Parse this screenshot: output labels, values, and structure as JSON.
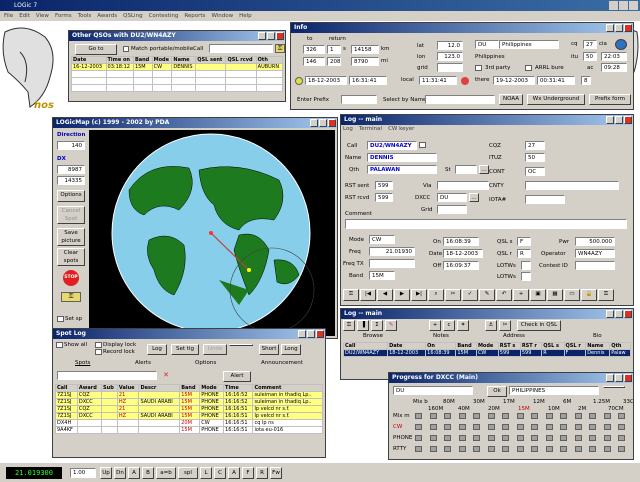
{
  "app": {
    "title": "LOGic 7",
    "menu": [
      "File",
      "Edit",
      "View",
      "Forms",
      "Tools",
      "Awards",
      "QSLing",
      "Contesting",
      "Reports",
      "Window",
      "Help"
    ]
  },
  "qso_window": {
    "title": "Other QSOs with DU2/WN4AZY",
    "goto": "Go to",
    "match_label": "Match portable/mobile",
    "call_label": "Call",
    "columns": [
      "Date",
      "Time on",
      "Band",
      "Mode",
      "Name",
      "QSL sent",
      "QSL rcvd",
      "Oth"
    ],
    "row": [
      "16-12-2003",
      "03:18:12",
      "15M",
      "CW",
      "DENNIS",
      "",
      "",
      "AUBURN"
    ]
  },
  "info": {
    "title": "Info",
    "to_label": "to",
    "return_label": "return",
    "km": [
      "326",
      "1",
      "14158"
    ],
    "mi": [
      "146",
      "208",
      "8790"
    ],
    "unit_s": "s",
    "unit_km": "km",
    "unit_mi": "mi",
    "lat_label": "lat",
    "lat": "12.0",
    "lon_label": "lon",
    "lon": "123.0",
    "grid_label": "grid",
    "grid": "",
    "date": "18-12-2003",
    "time": "16:31:41",
    "local_label": "local",
    "local_time": "11:31:41",
    "there_label": "there",
    "there_date": "19-12-2003",
    "there_time": "00:31:41",
    "entity": "DU",
    "country": "Philippines",
    "cq_label": "cq",
    "cq": "27",
    "cia": "cia",
    "itu_label": "itu",
    "itu": "50",
    "time2": "22:03",
    "ac_label": "ac",
    "ac": "09:28",
    "third_party": "3rd party",
    "arrl": "ARRL bure",
    "prefix_label": "Enter Prefix",
    "select_label": "Select by Name",
    "noaa": "NOAA",
    "wx": "Wx Underground",
    "prefix_form": "Prefix form",
    "there_extra": "8"
  },
  "map": {
    "title": "LOGicMap  (c) 1999 - 2002 by PDA",
    "direction_label": "Direction",
    "direction": "140",
    "dx_label": "DX",
    "dx1": "8987",
    "dx2": "14335",
    "options": "Options",
    "cancel_label": "Cancel Spot",
    "save": "Save picture",
    "clear": "Clear spots",
    "stop": "STOP",
    "set_lbl": "Set sp"
  },
  "log": {
    "title": "Log -- main",
    "menu": [
      "Log",
      "Terminal",
      "CW keyer"
    ],
    "call_label": "Call",
    "call": "DU2/WN4AZY",
    "name_label": "Name",
    "name": "DENNIS",
    "qth_label": "Qth",
    "qth": "PALAWAN",
    "st_label": "St",
    "rst_sent_label": "RST sent",
    "rst_sent": "599",
    "rst_rcvd_label": "RST rcvd",
    "rst_rcvd": "599",
    "via_label": "Via",
    "dxcc_label": "DXCC",
    "dxcc": "DU",
    "grid_label": "Grid",
    "cqz_label": "CQZ",
    "cqz": "27",
    "ituz_label": "ITUZ",
    "ituz": "50",
    "cont_label": "CONT",
    "cont": "OC",
    "cnty_label": "CNTY",
    "iota_label": "IOTA#",
    "comment_label": "Comment",
    "mode_label": "Mode",
    "mode": "CW",
    "freq_label": "Freq",
    "freq": "21.01930",
    "freqrx_label": "Freq TX",
    "band_label": "Band",
    "band": "15M",
    "on_label": "On",
    "on": "16:08:39",
    "date_label": "Date",
    "date": "18-12-2003",
    "off_label": "Off",
    "off": "16:09:37",
    "qsls_label": "QSL s",
    "qsls": "F",
    "qslr_label": "QSL r",
    "qslr": "R",
    "lotws_label": "LOTWs",
    "lotwr_label": "LOTWs",
    "pwr_label": "Pwr",
    "pwr": "500.000",
    "op_label": "Operator",
    "op": "WN4AZY",
    "contest_label": "Contest ID"
  },
  "logmain": {
    "title": "Log -- main",
    "btns": [
      "Browse",
      "Notes",
      "Address",
      "Bio"
    ],
    "checkin": "Check in QSL",
    "columns": [
      "Call",
      "Date",
      "On",
      "Band",
      "Mode",
      "RST s",
      "RST r",
      "QSL s",
      "QSL r",
      "Name",
      "Qth"
    ],
    "row": [
      "DU2/WN4AZY",
      "18-12-2003",
      "16:08:39",
      "15M",
      "CW",
      "599",
      "599",
      "R",
      "F",
      "Dennis",
      "Palaw"
    ]
  },
  "spot": {
    "title": "Spot Log",
    "show_all": "Show all",
    "display_lock": "Display lock",
    "record_lock": "Record lock",
    "log": "Log",
    "set": "Set tig",
    "undo": "Undo",
    "short": "Short",
    "long": "Long",
    "tabs": [
      "Spots",
      "Alerts",
      "Options",
      "Announcement"
    ],
    "alert": "Alert",
    "columns": [
      "Call",
      "Award",
      "Sub",
      "Value",
      "Descr",
      "Band",
      "Mode",
      "Time",
      "Comment"
    ],
    "rows": [
      [
        "7Z1SJ",
        "CQZ",
        "",
        "21",
        "",
        "15M",
        "PHONE",
        "16:16:52",
        "suleiman in thadiq Lp.."
      ],
      [
        "7Z1SJ",
        "DXCC",
        "",
        "HZ",
        "SAUDI ARABI",
        "15M",
        "PHONE",
        "16:16:52",
        "suleiman in thadiq Lp.."
      ],
      [
        "7Z1SJ",
        "CQZ",
        "",
        "21",
        "",
        "15M",
        "PHONE",
        "16:16:51",
        "lp velcd nr s.f."
      ],
      [
        "7Z1SJ",
        "DXCC",
        "",
        "HZ",
        "SAUDI ARABI",
        "15M",
        "PHONE",
        "16:16:51",
        "lp velcd nr s.f."
      ],
      [
        "DX4H",
        "",
        "",
        "",
        "",
        "20M",
        "CW",
        "16:16:51",
        "cq lp ns"
      ],
      [
        "9A4KF",
        "",
        "",
        "",
        "",
        "15M",
        "PHONE",
        "16:16:51",
        "iota eu-016"
      ]
    ]
  },
  "dxcc": {
    "title": "Progress for DXCC (Main)",
    "entity": "DU",
    "ok": "Ok",
    "country": "PHILIPPINES",
    "bands": [
      "Mix b",
      "160M",
      "80M",
      "40M",
      "30M",
      "20M",
      "17M",
      "15M",
      "12M",
      "10M",
      "6M",
      "2M",
      "1.25M",
      "70CM",
      "33CM"
    ],
    "rows": [
      "Mix m",
      "CW",
      "PHONE",
      "RTTY"
    ]
  },
  "status": {
    "freq": "21.019300",
    "step": "1.00",
    "btns": [
      "Up",
      "Dn",
      "A",
      "B",
      "a=b",
      "spl",
      "L",
      "C",
      "A",
      "F",
      "R",
      "Fw"
    ]
  },
  "palette": {
    "title_bg": "#0a246a",
    "map_ocean": "#87ceeb",
    "land": "#1e7a1e",
    "face": "#d4d0c8"
  }
}
